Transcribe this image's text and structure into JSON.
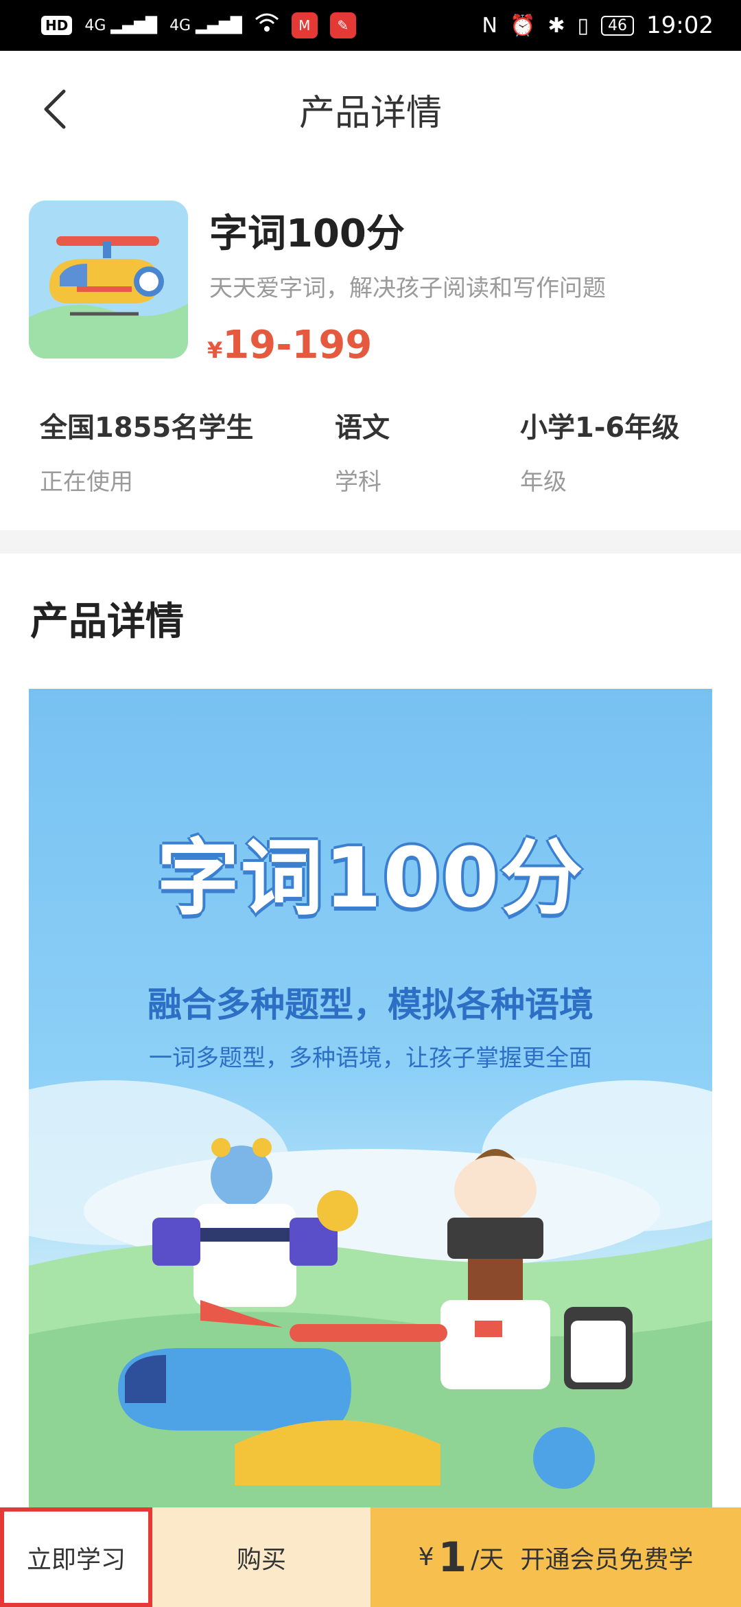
{
  "status_bar": {
    "left_indicators": [
      "HD",
      "4G",
      "4G"
    ],
    "time": "19:02",
    "battery": "46",
    "right_icons": [
      "nfc-icon",
      "alarm-icon",
      "bluetooth-icon",
      "vibrate-icon"
    ]
  },
  "header": {
    "title": "产品详情"
  },
  "product": {
    "name": "字词100分",
    "description": "天天爱字词，解决孩子阅读和写作问题",
    "price_symbol": "¥",
    "price_range": "19-199"
  },
  "stats": [
    {
      "value": "全国1855名学生",
      "label": "正在使用"
    },
    {
      "value": "语文",
      "label": "学科"
    },
    {
      "value": "小学1-6年级",
      "label": "年级"
    }
  ],
  "detail_section": {
    "title": "产品详情"
  },
  "banner": {
    "title": "字词100分",
    "slogan": "融合多种题型，模拟各种语境",
    "subtitle": "一词多题型，多种语境，让孩子掌握更全面"
  },
  "bottom_bar": {
    "study_label": "立即学习",
    "buy_label": "购买",
    "vip_currency": "¥",
    "vip_amount": "1",
    "vip_unit": "/天",
    "vip_text": "开通会员免费学"
  },
  "colors": {
    "price": "#e55a3e",
    "vip_button": "#f7c04e",
    "buy_button": "#fbe9c9",
    "highlight_border": "#e53935"
  }
}
